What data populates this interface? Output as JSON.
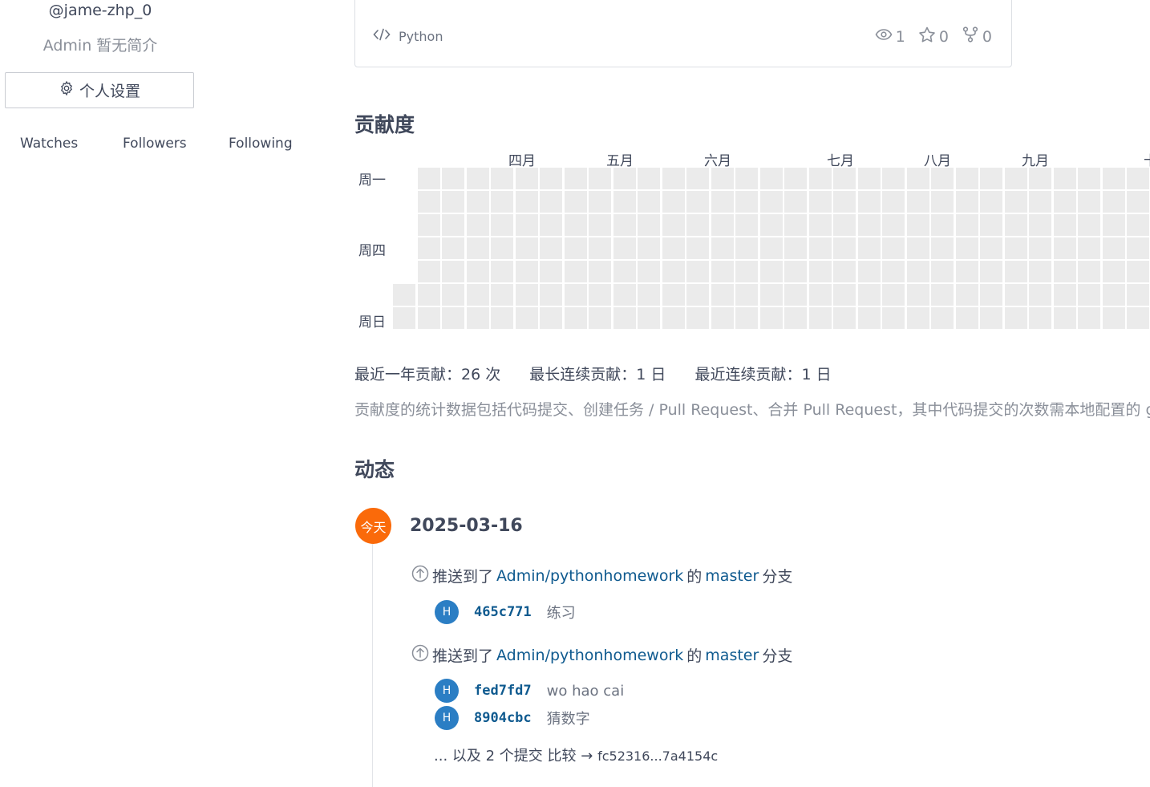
{
  "profile": {
    "handle": "@jame-zhp_0",
    "bio": "Admin 暂无简介",
    "settings_label": "个人设置",
    "stats": {
      "watches": "Watches",
      "followers": "Followers",
      "following": "Following"
    }
  },
  "repo_card": {
    "language": "Python",
    "watchers": "1",
    "stars": "0",
    "forks": "0"
  },
  "contributions": {
    "title": "贡献度",
    "months": [
      "四月",
      "五月",
      "六月",
      "七月",
      "八月",
      "九月",
      "十"
    ],
    "day_labels": [
      "周一",
      "周四",
      "周日"
    ],
    "last_year": "最近一年贡献：26 次",
    "longest_streak": "最长连续贡献：1 日",
    "current_streak": "最近连续贡献：1 日",
    "note": "贡献度的统计数据包括代码提交、创建任务 / Pull Request、合并 Pull Request，其中代码提交的次数需本地配置的 git 邮箱是 Gitee 账号已确认绑定的才会被统计"
  },
  "activity": {
    "title": "动态",
    "today_label": "今天",
    "date": "2025-03-16",
    "events": [
      {
        "prefix": "推送到了",
        "repo": "Admin/pythonhomework",
        "mid": "的",
        "branch": "master",
        "suffix": "分支",
        "commits": [
          {
            "avatar": "H",
            "sha": "465c771",
            "message": "练习"
          }
        ]
      },
      {
        "prefix": "推送到了",
        "repo": "Admin/pythonhomework",
        "mid": "的",
        "branch": "master",
        "suffix": "分支",
        "commits": [
          {
            "avatar": "H",
            "sha": "fed7fd7",
            "message": "wo hao cai"
          },
          {
            "avatar": "H",
            "sha": "8904cbc",
            "message": "猜数字"
          }
        ],
        "more": "... 以及 2 个提交",
        "compare": "比较 →",
        "range": "fc52316...7a4154c"
      }
    ]
  },
  "colors": {
    "accent": "#fa6a0a",
    "link": "#0f5a8f",
    "avatar": "#2b7ec4",
    "cell_empty": "#ebebeb"
  }
}
